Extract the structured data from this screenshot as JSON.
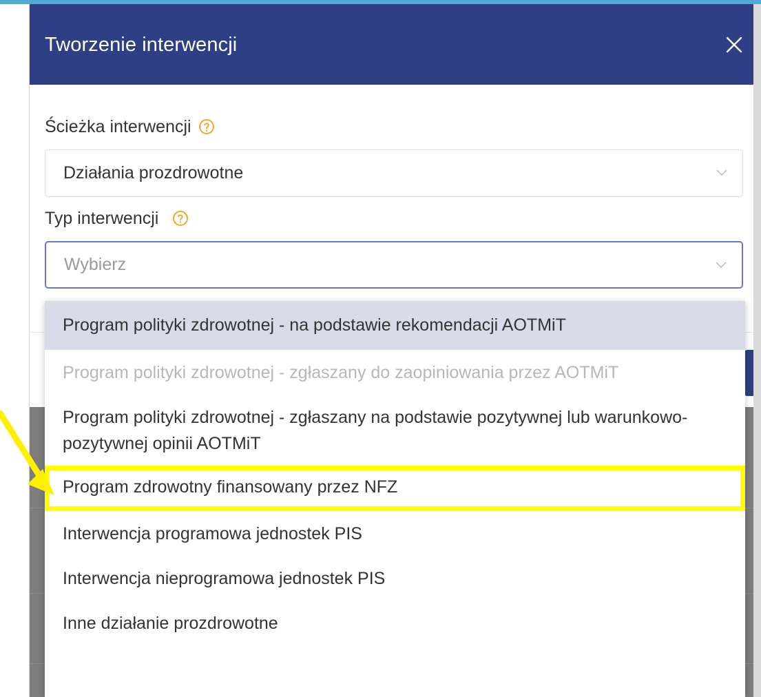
{
  "modal": {
    "title": "Tworzenie interwencji",
    "close_label": "X"
  },
  "fields": {
    "path": {
      "label": "Ścieżka interwencji",
      "value": "Działania prozdrowotne",
      "help_icon": "question-circle-icon",
      "dropdown_icon": "chevron-down-icon"
    },
    "type": {
      "label": "Typ interwencji",
      "placeholder": "Wybierz",
      "help_icon": "question-circle-icon",
      "dropdown_icon": "chevron-down-icon"
    }
  },
  "dropdown": {
    "options": [
      "Program polityki zdrowotnej - na podstawie rekomendacji AOTMiT",
      "Program polityki zdrowotnej - zgłaszany do zaopiniowania przez AOTMiT",
      "Program polityki zdrowotnej - zgłaszany na podstawie pozytywnej lub warunkowo-pozytywnej opinii AOTMiT",
      "Program zdrowotny finansowany przez NFZ",
      "Interwencja programowa jednostek PIS",
      "Interwencja nieprogramowa jednostek PIS",
      "Inne działanie prozdrowotne"
    ],
    "active_index": 0,
    "disabled_index": 1,
    "highlighted_index": 3
  },
  "colors": {
    "header": "#2f3f86",
    "help_icon": "#f5a623",
    "focus_border": "#6179c6",
    "active_option": "#dadbe8",
    "annotation": "#ffff00"
  }
}
